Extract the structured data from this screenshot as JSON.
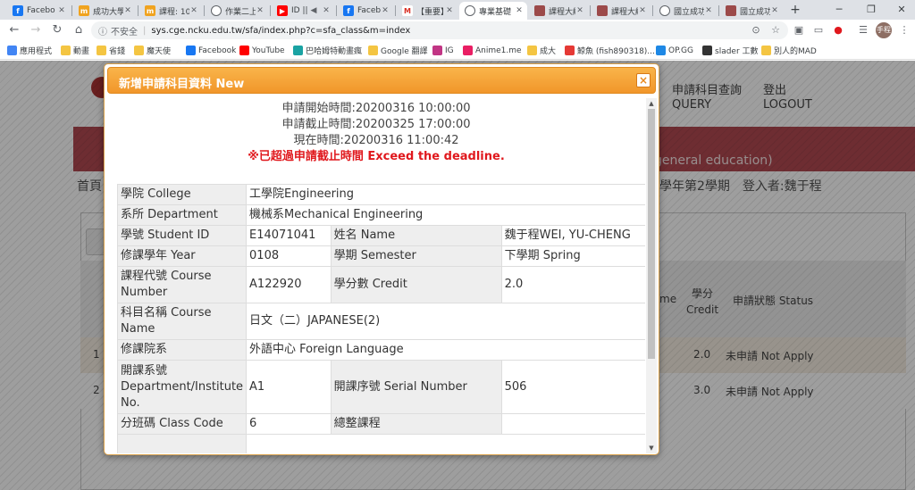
{
  "browser": {
    "tabs": [
      {
        "label": "Facebo",
        "favicon": "facebook-favicon",
        "color": "#1877f2"
      },
      {
        "label": "成功大學",
        "favicon": "ncku-favicon",
        "color": "#f0a31f"
      },
      {
        "label": "課程: 10",
        "favicon": "ncku-favicon",
        "color": "#f0a31f"
      },
      {
        "label": "作業二上",
        "favicon": "globe-favicon",
        "color": "#5f6368"
      },
      {
        "label": "ID ||",
        "favicon": "youtube-favicon",
        "color": "#ff0000"
      },
      {
        "label": "Facebo",
        "favicon": "facebook-favicon",
        "color": "#1877f2"
      },
      {
        "label": "【重要】",
        "favicon": "gmail-favicon",
        "color": "#d93025"
      },
      {
        "label": "專業基礎",
        "favicon": "globe-favicon",
        "color": "#5f6368"
      },
      {
        "label": "課程大綱",
        "favicon": "ncku-seal-favicon",
        "color": "#9c4a4a"
      },
      {
        "label": "課程大綱",
        "favicon": "ncku-seal-favicon",
        "color": "#9c4a4a"
      },
      {
        "label": "國立成功",
        "favicon": "globe-favicon",
        "color": "#5f6368"
      },
      {
        "label": "國立成功",
        "favicon": "ncku-seal-favicon",
        "color": "#9c4a4a"
      }
    ],
    "active_tab_index": 7,
    "address": {
      "insecure_label": "不安全",
      "url": "sys.cge.ncku.edu.tw/sfa/index.php?c=sfa_class&m=index"
    },
    "profile_initials": "手程",
    "bookmarks": [
      {
        "label": "應用程式",
        "icon": "apps-icon",
        "color": "#4285f4"
      },
      {
        "label": "動畫",
        "icon": "folder-icon",
        "color": "#f4c542"
      },
      {
        "label": "省錢",
        "icon": "folder-icon",
        "color": "#f4c542"
      },
      {
        "label": "魔天使",
        "icon": "folder-icon",
        "color": "#f4c542"
      },
      {
        "label": "Facebook",
        "icon": "facebook-icon",
        "color": "#1877f2"
      },
      {
        "label": "YouTube",
        "icon": "youtube-icon",
        "color": "#ff0000"
      },
      {
        "label": "巴哈姆特動畫瘋",
        "icon": "bahamut-icon",
        "color": "#1aa3a3"
      },
      {
        "label": "Google 翻譯",
        "icon": "folder-icon",
        "color": "#f4c542"
      },
      {
        "label": "IG",
        "icon": "instagram-icon",
        "color": "#c13584"
      },
      {
        "label": "Anime1.me",
        "icon": "anime1-icon",
        "color": "#e91e63"
      },
      {
        "label": "成大",
        "icon": "folder-icon",
        "color": "#f4c542"
      },
      {
        "label": "鯨魚 (fish890318)...",
        "icon": "fish-icon",
        "color": "#e53935"
      },
      {
        "label": "OP.GG",
        "icon": "opgg-icon",
        "color": "#1e88e5"
      },
      {
        "label": "slader 工數",
        "icon": "slader-icon",
        "color": "#333333"
      },
      {
        "label": "別人的MAD",
        "icon": "folder-icon",
        "color": "#f4c542"
      }
    ]
  },
  "background_page": {
    "menu": [
      {
        "line1": "申請科目查詢",
        "line2": "QUERY"
      },
      {
        "line1": "登出",
        "line2": "LOGOUT"
      }
    ],
    "banner_text": "general education)",
    "breadcrumb_left": "首頁",
    "breadcrumb_right": "學年第2學期　登入者:魏于程",
    "table_headers": [
      "me",
      "學分 Credit",
      "申請狀態 Status"
    ],
    "rows": [
      {
        "index": "1",
        "credit": "2.0",
        "status": "未申請 Not Apply"
      },
      {
        "index": "2",
        "credit": "3.0",
        "status": "未申請 Not Apply"
      }
    ]
  },
  "modal": {
    "title": "新增申請科目資料 New",
    "close_label": "×",
    "apply_start": "申請開始時間:20200316 10:00:00",
    "apply_end": "申請截止時間:20200325 17:00:00",
    "now": "現在時間:20200316 11:00:42",
    "warning": "※已超過申請截止時間 Exceed the deadline.",
    "fields": {
      "college_label": "學院 College",
      "college_value": "工學院Engineering",
      "department_label": "系所 Department",
      "department_value": "機械系Mechanical Engineering",
      "student_id_label": "學號 Student ID",
      "student_id_value": "E14071041",
      "name_label": "姓名 Name",
      "name_value": "魏于程WEI, YU-CHENG",
      "year_label": "修課學年 Year",
      "year_value": "0108",
      "semester_label": "學期 Semester",
      "semester_value": "下學期 Spring",
      "course_number_label": "課程代號 Course Number",
      "course_number_value": "A122920",
      "credit_label": "學分數 Credit",
      "credit_value": "2.0",
      "course_name_label": "科目名稱 Course Name",
      "course_name_value": "日文（二）JAPANESE(2)",
      "school_label": "修課院系",
      "school_value": "外語中心 Foreign Language",
      "dept_no_label": "開課系號 Department/Institute No.",
      "dept_no_value": "A1",
      "serial_label": "開課序號 Serial Number",
      "serial_value": "506",
      "class_code_label": "分班碼 Class Code",
      "class_code_value": "6",
      "general_label": "總整課程",
      "general_value": ""
    }
  }
}
